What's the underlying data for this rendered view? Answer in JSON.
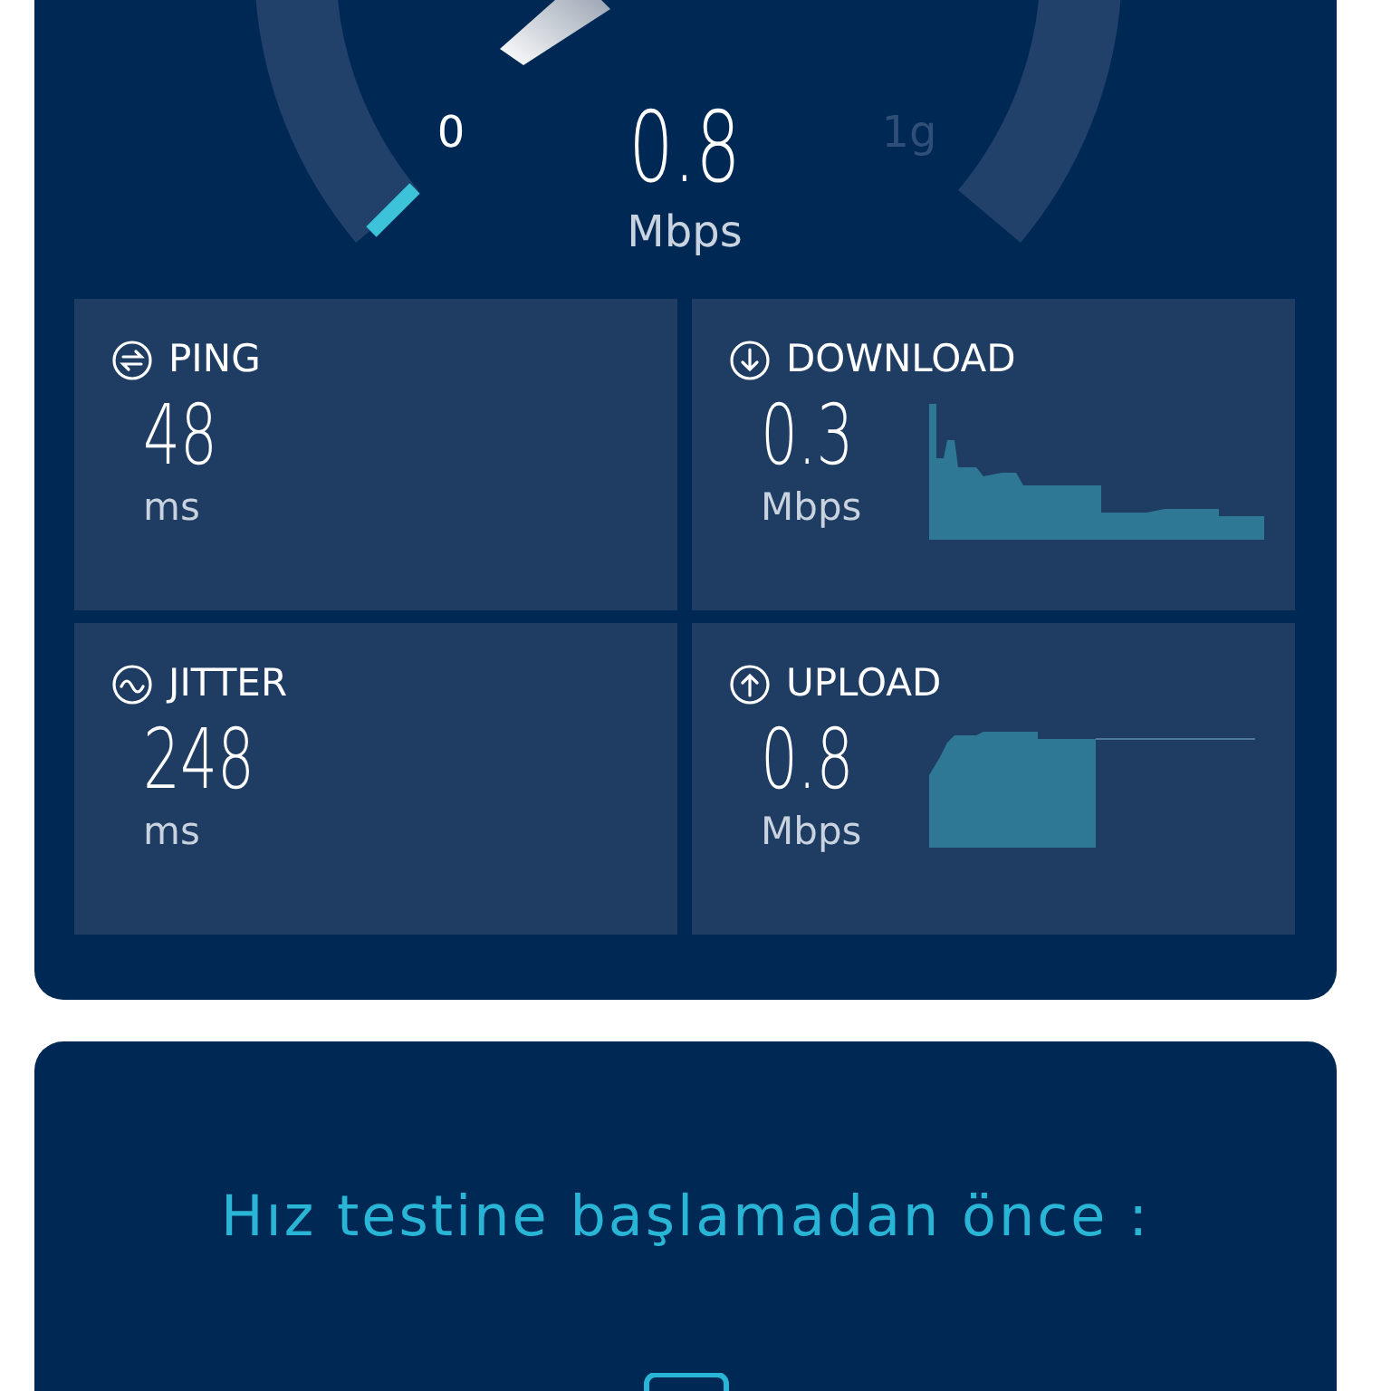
{
  "gauge": {
    "min_label": "0",
    "value": "0.8",
    "unit": "Mbps",
    "max_label": "1g"
  },
  "tiles": [
    {
      "kind": "ping",
      "title": "PING",
      "value": "48",
      "unit": "ms"
    },
    {
      "kind": "download",
      "title": "DOWNLOAD",
      "value": "0.3",
      "unit": "Mbps"
    },
    {
      "kind": "jitter",
      "title": "JITTER",
      "value": "248",
      "unit": "ms"
    },
    {
      "kind": "upload",
      "title": "UPLOAD",
      "value": "0.8",
      "unit": "Mbps"
    }
  ],
  "notice": {
    "heading": "Hız testine başlamadan önce :"
  }
}
